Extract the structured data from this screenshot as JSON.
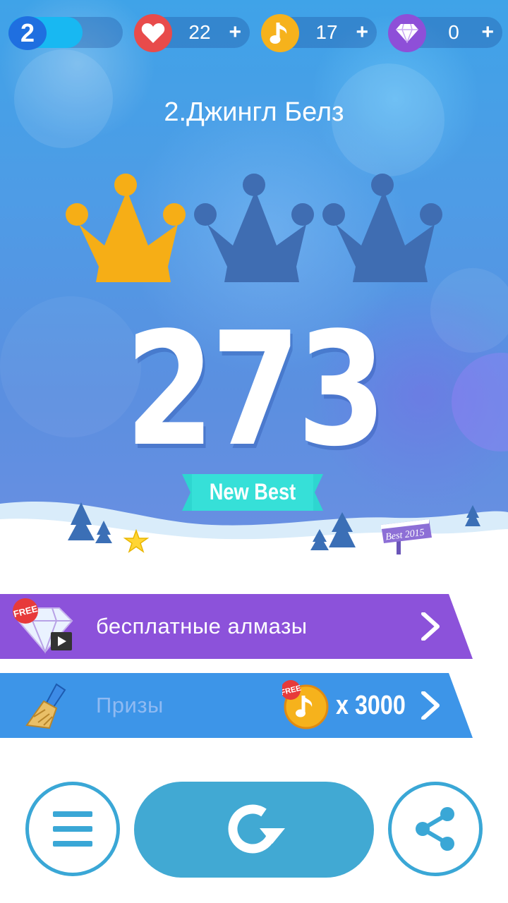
{
  "header": {
    "level": "2",
    "level_progress": 0.65,
    "lives": {
      "value": "22",
      "plus": "+",
      "icon": "heart-icon",
      "color": "#e84b4b"
    },
    "notes": {
      "value": "17",
      "plus": "+",
      "icon": "music-note-icon",
      "color": "#f6b21c"
    },
    "diamonds": {
      "value": "0",
      "plus": "+",
      "icon": "diamond-icon",
      "color": "#8e4fd8"
    }
  },
  "song": {
    "title": "2.Джингл Белз"
  },
  "result": {
    "crowns_earned": 1,
    "crowns_total": 3,
    "score": "273",
    "badge": "New Best",
    "sign_label": "Best 2015"
  },
  "offers": {
    "free_diamonds": {
      "badge": "FREE",
      "label": "бесплатные алмазы",
      "color": "#8c52da"
    },
    "prizes": {
      "label": "Призы",
      "badge": "FREE",
      "reward": "x 3000",
      "color": "#3d95e8"
    }
  },
  "actions": {
    "menu_icon": "hamburger-menu-icon",
    "retry_icon": "retry-icon",
    "share_icon": "share-icon"
  },
  "colors": {
    "crown_gold": "#f6ae16",
    "crown_empty": "#3f6db2",
    "ribbon": "#2ed6d0",
    "button_blue": "#41a9d3"
  }
}
